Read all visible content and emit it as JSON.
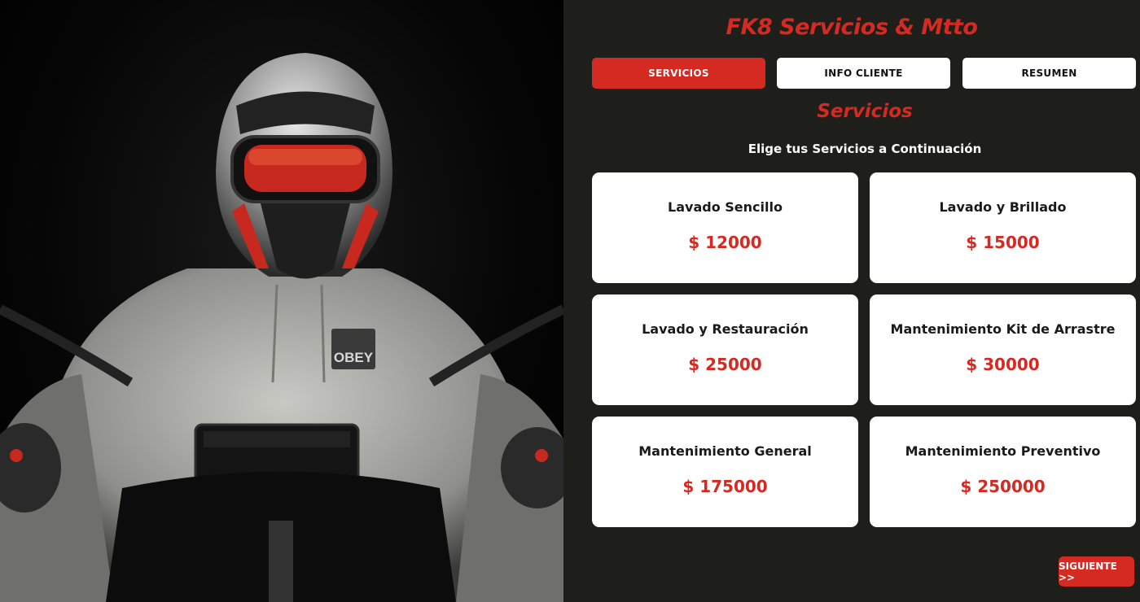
{
  "brand": {
    "title": "FK8 Servicios & Mtto"
  },
  "tabs": [
    {
      "label": "SERVICIOS",
      "active": true
    },
    {
      "label": "INFO CLIENTE",
      "active": false
    },
    {
      "label": "RESUMEN",
      "active": false
    }
  ],
  "section": {
    "title": "Servicios",
    "subtitle": "Elige tus Servicios a Continuación"
  },
  "services": [
    {
      "name": "Lavado Sencillo",
      "price": "$ 12000"
    },
    {
      "name": "Lavado y Brillado",
      "price": "$ 15000"
    },
    {
      "name": "Lavado y Restauración",
      "price": "$ 25000"
    },
    {
      "name": "Mantenimiento Kit de Arrastre",
      "price": "$ 30000"
    },
    {
      "name": "Mantenimiento General",
      "price": "$ 175000"
    },
    {
      "name": "Mantenimiento Preventivo",
      "price": "$ 250000"
    }
  ],
  "hero": {
    "logo_text": "OBEY"
  },
  "actions": {
    "next_label": "SIGUIENTE >>"
  },
  "colors": {
    "accent": "#d52a22",
    "panel_bg": "#1e1f1a",
    "card_bg": "#ffffff"
  }
}
